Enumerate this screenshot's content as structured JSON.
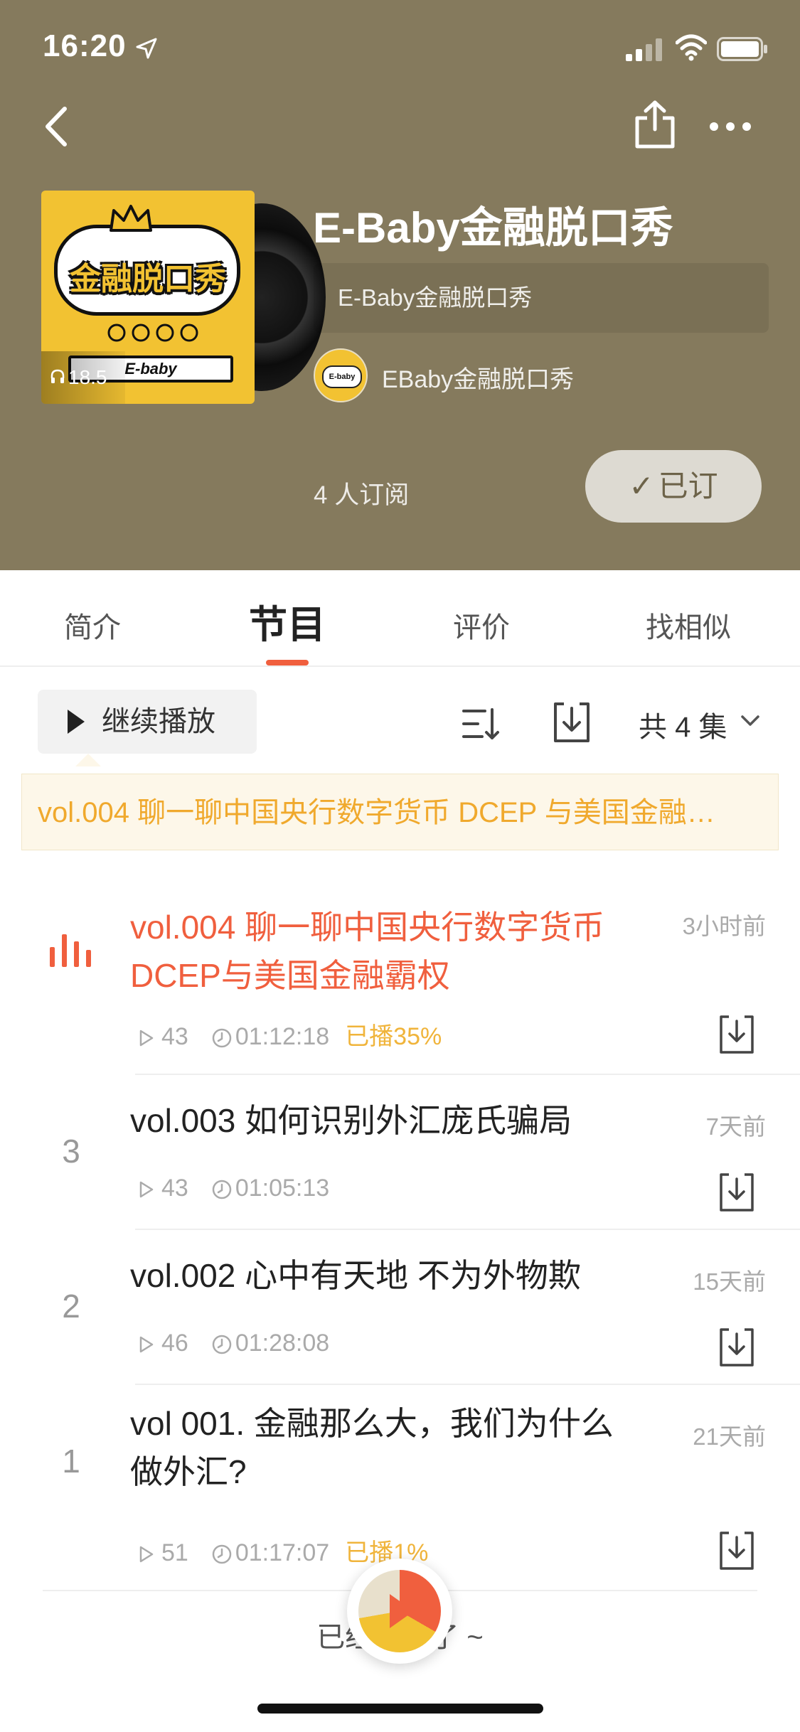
{
  "status_bar": {
    "time": "16:20"
  },
  "cover": {
    "art_title": "金融脱口秀",
    "brand_text": "E-baby",
    "play_count": "18.5"
  },
  "podcast": {
    "title": "E-Baby金融脱口秀",
    "description": "E-Baby金融脱口秀",
    "author": "EBaby金融脱口秀",
    "subscribers": "4 人订阅",
    "subscribe_label": "已订",
    "subscribe_check": "✓"
  },
  "tabs": [
    {
      "label": "简介"
    },
    {
      "label": "节目"
    },
    {
      "label": "评价"
    },
    {
      "label": "找相似"
    }
  ],
  "active_tab": "节目",
  "toolbar": {
    "continue_label": "继续播放",
    "count_label": "共 4 集"
  },
  "banner": {
    "text": "vol.004 聊一聊中国央行数字货币 DCEP 与美国金融…"
  },
  "episodes": [
    {
      "index": "",
      "title": "vol.004 聊一聊中国央行数字货币DCEP与美国金融霸权",
      "time": "3小时前",
      "plays": "43",
      "duration": "01:12:18",
      "progress": "已播35%",
      "playing": true
    },
    {
      "index": "3",
      "title": "vol.003 如何识别外汇庞氏骗局",
      "time": "7天前",
      "plays": "43",
      "duration": "01:05:13",
      "progress": ""
    },
    {
      "index": "2",
      "title": "vol.002 心中有天地 不为外物欺",
      "time": "15天前",
      "plays": "46",
      "duration": "01:28:08",
      "progress": ""
    },
    {
      "index": "1",
      "title": "vol 001. 金融那么大，我们为什么做外汇?",
      "time": "21天前",
      "plays": "51",
      "duration": "01:17:07",
      "progress": "已播1%"
    }
  ],
  "footer": {
    "end_text": "已经到底了 ~"
  },
  "colors": {
    "header_bg": "#857a5d",
    "accent": "#f05f3e",
    "banner_text": "#f0a92d",
    "progress_text": "#f0b43b"
  }
}
